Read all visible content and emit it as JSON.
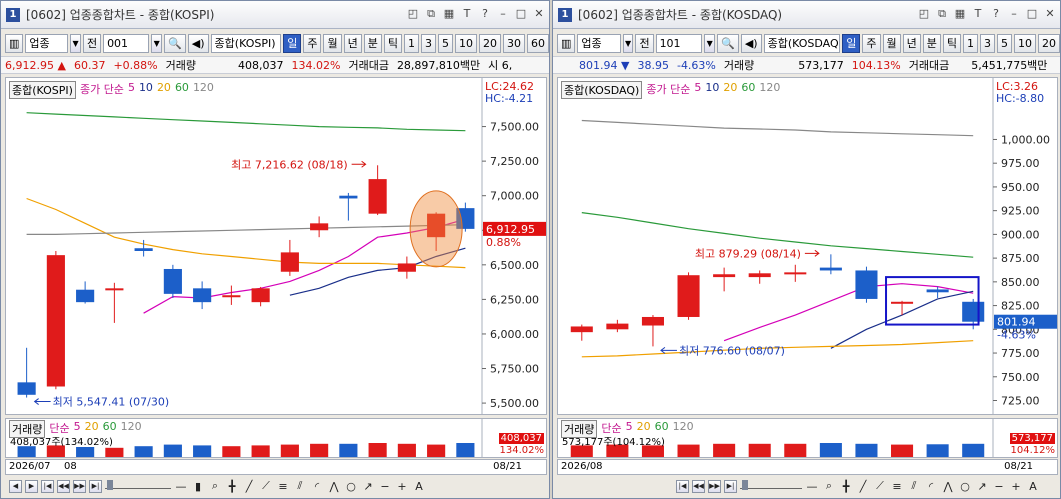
{
  "windows": [
    {
      "title": "[0602] 업종종합차트 - 종합(KOSPI)",
      "toolbar": {
        "type": "업종",
        "period_label": "전",
        "code": "001",
        "name": "종합(KOSPI)",
        "periods": [
          "일",
          "주",
          "월",
          "년",
          "분",
          "틱"
        ],
        "selected_period": "일",
        "nums": [
          "1",
          "3",
          "5",
          "10",
          "20",
          "30",
          "60"
        ]
      },
      "info": {
        "price": "6,912.95",
        "arrow": "▲",
        "change": "60.37",
        "pct": "+0.88%",
        "vol_label": "거래량",
        "volume": "408,037",
        "vol_pct": "134.02%",
        "amount_label": "거래대금",
        "amount": "28,897,810백만",
        "extra": "시  6,"
      },
      "legend": {
        "name": "종합(KOSPI)",
        "ma_label": "종가 단순",
        "ma": [
          "5",
          "10",
          "20",
          "60",
          "120"
        ]
      },
      "lc": "LC:24.62",
      "hc": "HC:-4.21",
      "current_price": "6,912.95",
      "current_pct": "0.88%",
      "high_label": "최고 7,216.62 (08/18)",
      "low_label": "최저 5,547.41 (07/30)",
      "vol_legend": {
        "name": "거래량",
        "ma_label": "단순",
        "ma": [
          "5",
          "20",
          "60",
          "120"
        ]
      },
      "vol_text": "408,037주(134.02%)",
      "vol_val": "408,037",
      "vol_pct_tag": "134.02%",
      "dates": [
        "2026/07",
        "08",
        "08/21"
      ]
    },
    {
      "title": "[0602] 업종종합차트 - 종합(KOSDAQ)",
      "toolbar": {
        "type": "업종",
        "period_label": "전",
        "code": "101",
        "name": "종합(KOSDAQ)",
        "periods": [
          "일",
          "주",
          "월",
          "년",
          "분",
          "틱"
        ],
        "selected_period": "일",
        "nums": [
          "1",
          "3",
          "5",
          "10",
          "20"
        ]
      },
      "info": {
        "price": "801.94",
        "arrow": "▼",
        "change": "38.95",
        "pct": "-4.63%",
        "vol_label": "거래량",
        "volume": "573,177",
        "vol_pct": "104.13%",
        "amount_label": "거래대금",
        "amount": "5,451,775백만",
        "extra": ""
      },
      "legend": {
        "name": "종합(KOSDAQ)",
        "ma_label": "종가 단순",
        "ma": [
          "5",
          "10",
          "20",
          "60",
          "120"
        ]
      },
      "lc": "LC:3.26",
      "hc": "HC:-8.80",
      "current_price": "801.94",
      "current_pct": "-4.63%",
      "high_label": "최고 879.29 (08/14)",
      "low_label": "최저 776.60 (08/07)",
      "vol_legend": {
        "name": "거래량",
        "ma_label": "단순",
        "ma": [
          "5",
          "20",
          "60",
          "120"
        ]
      },
      "vol_text": "573,177주(104.12%)",
      "vol_val": "573,177",
      "vol_pct_tag": "104.12%",
      "dates": [
        "2026/08",
        "08/21"
      ]
    }
  ],
  "chart_data": [
    {
      "type": "candlestick",
      "title": "종합(KOSPI)",
      "y_ticks": [
        7500,
        7250,
        7000,
        6750,
        6500,
        6250,
        6000,
        5750,
        5500
      ],
      "ylim": [
        5450,
        7750
      ],
      "candles": [
        {
          "o": 5650,
          "h": 5900,
          "l": 5540,
          "c": 5560
        },
        {
          "o": 5620,
          "h": 6600,
          "l": 5600,
          "c": 6570
        },
        {
          "o": 6320,
          "h": 6380,
          "l": 6220,
          "c": 6230
        },
        {
          "o": 6330,
          "h": 6370,
          "l": 6080,
          "c": 6330
        },
        {
          "o": 6620,
          "h": 6680,
          "l": 6560,
          "c": 6600
        },
        {
          "o": 6470,
          "h": 6500,
          "l": 6260,
          "c": 6290
        },
        {
          "o": 6330,
          "h": 6380,
          "l": 6180,
          "c": 6230
        },
        {
          "o": 6280,
          "h": 6350,
          "l": 6210,
          "c": 6280
        },
        {
          "o": 6230,
          "h": 6340,
          "l": 6200,
          "c": 6330
        },
        {
          "o": 6450,
          "h": 6680,
          "l": 6420,
          "c": 6590
        },
        {
          "o": 6750,
          "h": 6850,
          "l": 6700,
          "c": 6800
        },
        {
          "o": 7000,
          "h": 7020,
          "l": 6820,
          "c": 6980
        },
        {
          "o": 6870,
          "h": 7220,
          "l": 6860,
          "c": 7120
        },
        {
          "o": 6450,
          "h": 6560,
          "l": 6400,
          "c": 6510
        },
        {
          "o": 6700,
          "h": 6880,
          "l": 6600,
          "c": 6870
        },
        {
          "o": 6910,
          "h": 6950,
          "l": 6740,
          "c": 6760
        }
      ],
      "ma_series": [
        {
          "color": "#d400b8",
          "values": [
            null,
            null,
            null,
            null,
            6150,
            6270,
            6260,
            6300,
            6330,
            6380,
            6460,
            6560,
            6700,
            6730,
            6770,
            6830
          ]
        },
        {
          "color": "#1a2f8a",
          "values": [
            null,
            null,
            null,
            null,
            null,
            null,
            null,
            null,
            null,
            6280,
            6330,
            6410,
            6460,
            6480,
            6560,
            6620
          ]
        },
        {
          "color": "#f0a000",
          "values": [
            6980,
            6900,
            6800,
            6700,
            6650,
            6610,
            6580,
            6560,
            6540,
            6520,
            6510,
            6510,
            6510,
            6500,
            6490,
            6480
          ]
        },
        {
          "color": "#2a9a3a",
          "values": [
            7600,
            7590,
            7580,
            7570,
            7560,
            7550,
            7540,
            7530,
            7520,
            7510,
            7500,
            7495,
            7490,
            7480,
            7475,
            7470
          ]
        },
        {
          "color": "#888888",
          "values": [
            6720,
            6720,
            6725,
            6730,
            6735,
            6740,
            6745,
            6750,
            6755,
            6760,
            6765,
            6770,
            6775,
            6780,
            6785,
            6790
          ]
        }
      ],
      "volumes": [
        0.8,
        0.85,
        0.75,
        0.7,
        0.8,
        0.9,
        0.85,
        0.8,
        0.85,
        0.9,
        0.95,
        0.95,
        1.0,
        0.95,
        0.9,
        1.0
      ]
    },
    {
      "type": "candlestick",
      "title": "종합(KOSDAQ)",
      "y_ticks": [
        1000,
        975,
        950,
        925,
        900,
        875,
        850,
        825,
        800,
        775,
        750,
        725
      ],
      "ylim": [
        715,
        1050
      ],
      "candles": [
        {
          "o": 797,
          "h": 805,
          "l": 788,
          "c": 803
        },
        {
          "o": 800,
          "h": 810,
          "l": 797,
          "c": 806
        },
        {
          "o": 804,
          "h": 815,
          "l": 782,
          "c": 813
        },
        {
          "o": 813,
          "h": 860,
          "l": 810,
          "c": 857
        },
        {
          "o": 855,
          "h": 865,
          "l": 840,
          "c": 858
        },
        {
          "o": 855,
          "h": 862,
          "l": 848,
          "c": 859
        },
        {
          "o": 860,
          "h": 868,
          "l": 850,
          "c": 860
        },
        {
          "o": 865,
          "h": 879,
          "l": 858,
          "c": 862
        },
        {
          "o": 862,
          "h": 866,
          "l": 828,
          "c": 832
        },
        {
          "o": 829,
          "h": 830,
          "l": 815,
          "c": 829
        },
        {
          "o": 842,
          "h": 845,
          "l": 833,
          "c": 839
        },
        {
          "o": 829,
          "h": 832,
          "l": 800,
          "c": 808
        }
      ],
      "ma_series": [
        {
          "color": "#d400b8",
          "values": [
            null,
            null,
            null,
            null,
            788,
            802,
            815,
            830,
            845,
            848,
            845,
            838
          ]
        },
        {
          "color": "#1a2f8a",
          "values": [
            null,
            null,
            null,
            null,
            null,
            null,
            null,
            780,
            800,
            815,
            832,
            840
          ]
        },
        {
          "color": "#f0a000",
          "values": [
            771,
            772,
            774,
            776,
            778,
            780,
            781,
            782,
            783,
            784,
            786,
            788
          ]
        },
        {
          "color": "#2a9a3a",
          "values": [
            923,
            918,
            912,
            906,
            901,
            896,
            892,
            888,
            885,
            882,
            879,
            876
          ]
        },
        {
          "color": "#888888",
          "values": [
            1020,
            1018,
            1016,
            1014,
            1012,
            1011,
            1010,
            1008,
            1007,
            1006,
            1005,
            1004
          ]
        }
      ],
      "volumes": [
        0.85,
        0.9,
        0.85,
        0.9,
        0.95,
        0.95,
        0.95,
        1.0,
        0.95,
        0.9,
        0.92,
        0.95
      ]
    }
  ]
}
